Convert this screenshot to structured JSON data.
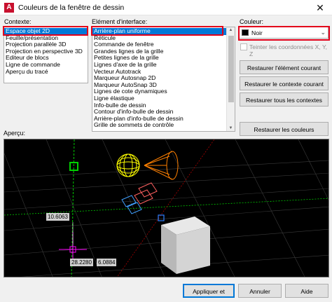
{
  "window": {
    "title": "Couleurs de la fenêtre de dessin",
    "app_icon_letter": "A",
    "close_glyph": "✕"
  },
  "context": {
    "label": "Contexte:",
    "items": [
      "Espace objet 2D",
      "Feuille/présentation",
      "Projection parallèle 3D",
      "Projection en perspective 3D",
      "Editeur de blocs",
      "Ligne de commande",
      "Aperçu du tracé"
    ],
    "selected_index": 0
  },
  "interface_element": {
    "label": "Elément d'interface:",
    "items": [
      "Arrière-plan uniforme",
      "Réticule",
      "Commande de fenêtre",
      "Grandes lignes de la grille",
      "Petites lignes de la grille",
      "Lignes d'axe de la grille",
      "Vecteur Autotrack",
      "Marqueur Autosnap 2D",
      "Marqueur AutoSnap 3D",
      "Lignes de cote dynamiques",
      "Ligne élastique",
      "Info-bulle de dessin",
      "Contour d'info-bulle de dessin",
      "Arrière-plan d'info-bulle de dessin",
      "Grille de sommets de contrôle"
    ],
    "selected_index": 0
  },
  "color": {
    "label": "Couleur:",
    "selected_value": "Noir",
    "swatch_color": "#000000",
    "tint_checkbox_label": "Teinter les coordonnées X, Y, Z"
  },
  "buttons": {
    "restore_current": "Restaurer l'élément courant",
    "restore_context": "Restaurer le contexte courant",
    "restore_all": "Restaurer tous les contextes",
    "restore_classic": "Restaurer les couleurs classiques",
    "apply_close": "Appliquer et fermer",
    "cancel": "Annuler",
    "help": "Aide"
  },
  "preview": {
    "label": "Aperçu:",
    "dim_value_1": "10.6063",
    "dim_value_2": "28.2280",
    "dim_value_3": "6.0884"
  },
  "colors": {
    "selection": "#0078d7",
    "highlight_frame": "#e2001a",
    "preview_background": "#000000",
    "axis_green": "#00c800",
    "axis_red": "#c80000"
  }
}
